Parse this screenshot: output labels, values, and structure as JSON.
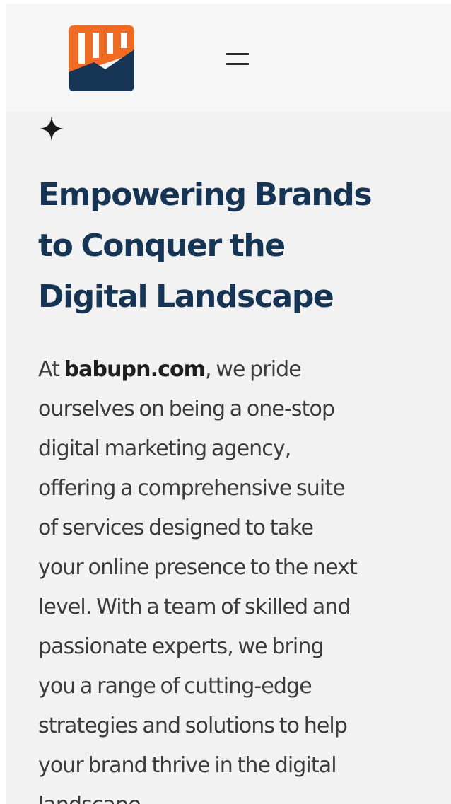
{
  "header": {
    "logo_name": "chart-growth-logo",
    "menu_icon": "hamburger-menu-icon",
    "colors": {
      "logo_orange": "#ef6a22",
      "logo_navy": "#163454",
      "header_bg": "#f7f7f7"
    }
  },
  "hero": {
    "sparkle_icon": "four-point-star-icon",
    "title_lines": [
      "Empowering Brands",
      "to Conquer the",
      "Digital Landscape"
    ],
    "intro_prefix": "At ",
    "brand": "babupn.com",
    "body_lines": [
      ", we pride",
      "ourselves on being a one-stop",
      "digital marketing agency,",
      "offering a comprehensive suite",
      "of services designed to take",
      "your online presence to the next",
      "level. With a team of skilled and",
      "passionate experts, we bring",
      "you a range of cutting-edge",
      "strategies and solutions to help",
      "your brand thrive in the digital",
      "landscape."
    ],
    "colors": {
      "title": "#163454",
      "body": "#3b3b3b",
      "content_bg": "#f2f2f2"
    }
  }
}
